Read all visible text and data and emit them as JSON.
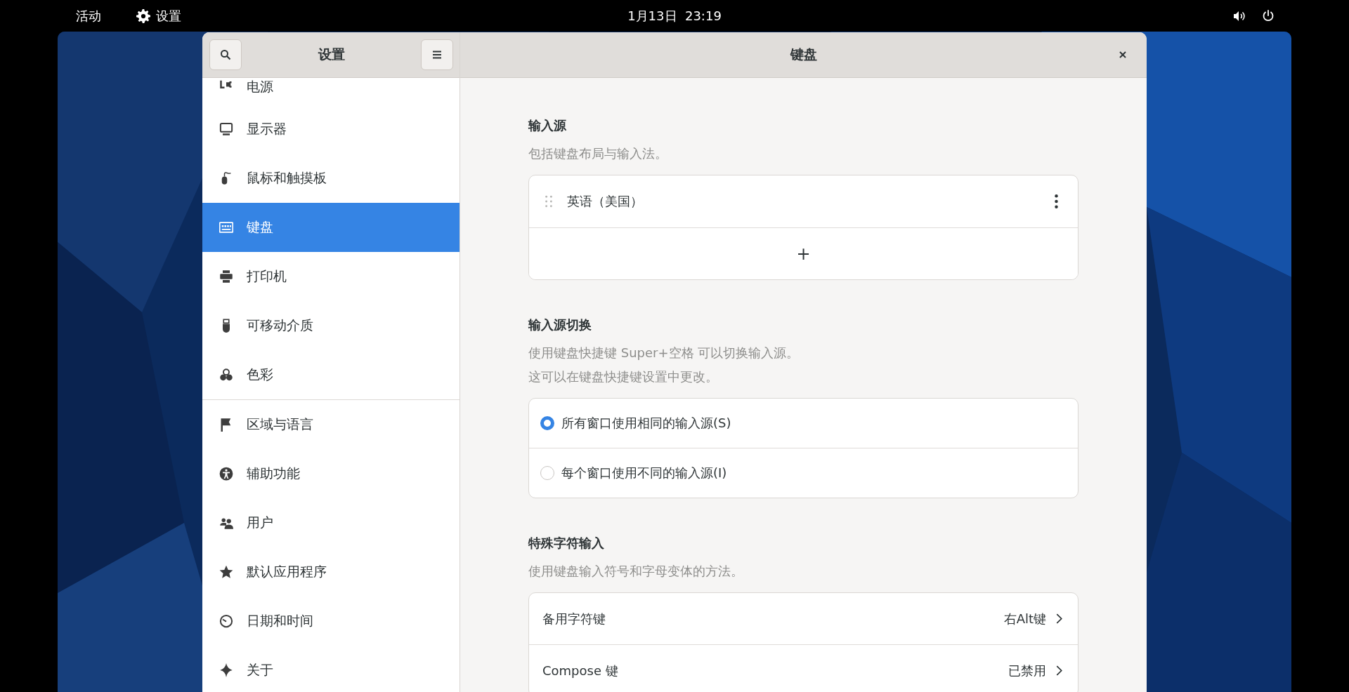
{
  "top_bar": {
    "activities": "活动",
    "app_menu": "设置",
    "clock": "1月13日  23:19"
  },
  "sidebar": {
    "title": "设置",
    "groups": [
      [
        {
          "label": "电源",
          "selected": false
        },
        {
          "label": "显示器",
          "selected": false
        },
        {
          "label": "鼠标和触摸板",
          "selected": false
        },
        {
          "label": "键盘",
          "selected": true
        },
        {
          "label": "打印机",
          "selected": false
        },
        {
          "label": "可移动介质",
          "selected": false
        },
        {
          "label": "色彩",
          "selected": false
        }
      ],
      [
        {
          "label": "区域与语言",
          "selected": false
        },
        {
          "label": "辅助功能",
          "selected": false
        },
        {
          "label": "用户",
          "selected": false
        },
        {
          "label": "默认应用程序",
          "selected": false
        },
        {
          "label": "日期和时间",
          "selected": false
        },
        {
          "label": "关于",
          "selected": false
        }
      ]
    ]
  },
  "content": {
    "title": "键盘",
    "sections": [
      {
        "kind": "sources",
        "heading": "输入源",
        "description": [
          "包括键盘布局与输入法。"
        ],
        "rows": [
          {
            "label": "英语（美国）"
          }
        ],
        "add_button": "+"
      },
      {
        "kind": "radio",
        "heading": "输入源切换",
        "description": [
          "使用键盘快捷键 Super+空格 可以切换输入源。",
          "这可以在键盘快捷键设置中更改。"
        ],
        "options": [
          {
            "label": "所有窗口使用相同的输入源(S)",
            "selected": true
          },
          {
            "label": "每个窗口使用不同的输入源(I)",
            "selected": false
          }
        ]
      },
      {
        "kind": "nav",
        "heading": "特殊字符输入",
        "description": [
          "使用键盘输入符号和字母变体的方法。"
        ],
        "rows": [
          {
            "label": "备用字符键",
            "value": "右Alt键"
          },
          {
            "label": "Compose 键",
            "value": "已禁用"
          }
        ]
      }
    ]
  }
}
